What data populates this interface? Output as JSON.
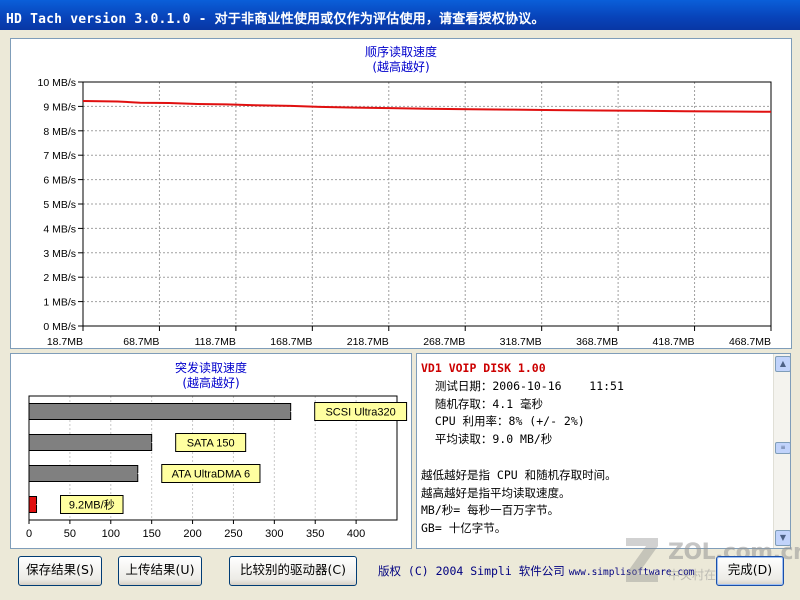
{
  "window": {
    "title": "HD Tach version 3.0.1.0",
    "title_separator": "-",
    "title_notice": "对于非商业性使用或仅作为评估使用，请查看授权协议。"
  },
  "sequential": {
    "title": "顺序读取速度",
    "subtitle": "(越高越好)",
    "y_ticks": [
      "10 MB/s",
      "9 MB/s",
      "8 MB/s",
      "7 MB/s",
      "6 MB/s",
      "5 MB/s",
      "4 MB/s",
      "3 MB/s",
      "2 MB/s",
      "1 MB/s",
      "0 MB/s"
    ],
    "x_ticks": [
      "18.7MB",
      "68.7MB",
      "118.7MB",
      "168.7MB",
      "218.7MB",
      "268.7MB",
      "318.7MB",
      "368.7MB",
      "418.7MB",
      "468.7MB"
    ]
  },
  "burst": {
    "title": "突发读取速度",
    "subtitle": "(越高越好)",
    "x_ticks": [
      "0",
      "50",
      "100",
      "150",
      "200",
      "250",
      "300",
      "350",
      "400"
    ]
  },
  "chart_data": [
    {
      "type": "line",
      "title": "顺序读取速度",
      "subtitle": "(越高越好)",
      "ylabel_unit": "MB/s",
      "ylim": [
        0,
        10
      ],
      "x_range_mb": [
        0,
        480
      ],
      "grid": true,
      "series": [
        {
          "color": "#E01010",
          "x": [
            0,
            24,
            40,
            60,
            80,
            100,
            120,
            145,
            165,
            190,
            215,
            240,
            270,
            300,
            330,
            360,
            390,
            420,
            450,
            480
          ],
          "y": [
            9.22,
            9.2,
            9.15,
            9.14,
            9.1,
            9.08,
            9.05,
            9.02,
            8.98,
            8.95,
            8.93,
            8.9,
            8.88,
            8.87,
            8.85,
            8.83,
            8.82,
            8.8,
            8.79,
            8.78
          ]
        }
      ]
    },
    {
      "type": "bar",
      "orientation": "horizontal",
      "title": "突发读取速度",
      "subtitle": "(越高越好)",
      "xlim": [
        0,
        450
      ],
      "categories": [
        "SCSI Ultra320",
        "SATA 150",
        "ATA UltraDMA 6",
        "9.2MB/秒"
      ],
      "values": [
        320,
        150,
        133,
        9.2
      ],
      "colors": [
        "#808080",
        "#808080",
        "#808080",
        "#E01010"
      ]
    }
  ],
  "info": {
    "header": "VD1 VOIP DISK 1.00",
    "lines": [
      "  测试日期：2006-10-16    11:51",
      "  随机存取：4.1 毫秒",
      "  CPU 利用率：8% (+/- 2%)",
      "  平均读取：9.0 MB/秒",
      "",
      "越低越好是指 CPU 和随机存取时间。",
      "越高越好是指平均读取速度。",
      "MB/秒= 每秒一百万字节。",
      "GB= 十亿字节。"
    ]
  },
  "buttons": {
    "save": "保存结果(S)",
    "upload": "上传结果(U)",
    "compare": "比较别的驱动器(C)",
    "done": "完成(D)"
  },
  "footer": {
    "copyright": "版权 (C) 2004 Simpli 软件公司",
    "url": "www.simplisoftware.com"
  },
  "watermark": {
    "text": "ZOL.com.cn",
    "sub": "中关村在线"
  },
  "colors": {
    "title_bar": "#0842B8",
    "accent_red": "#E01010",
    "bar_gray": "#808080",
    "label_yellow": "#FFFFA0"
  }
}
